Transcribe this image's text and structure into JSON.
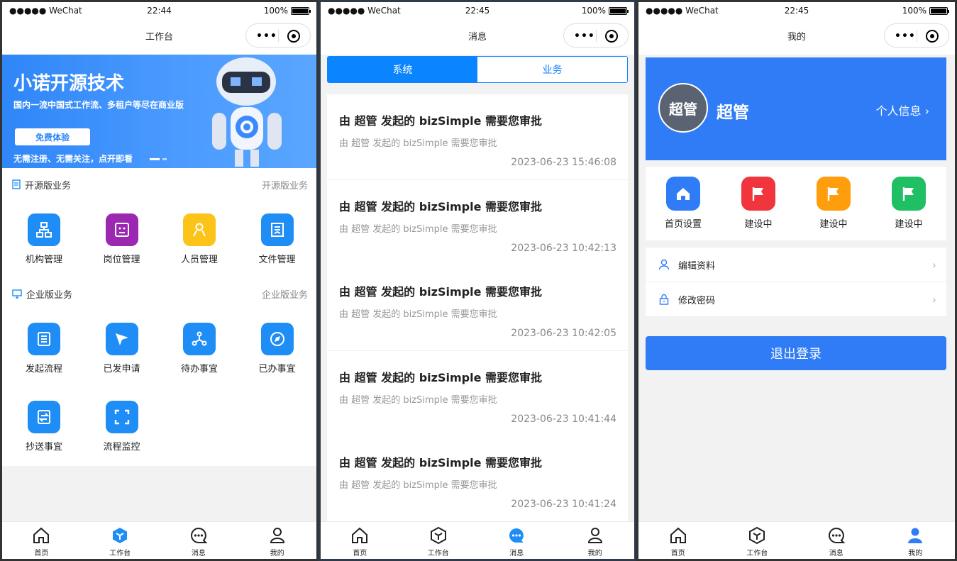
{
  "status": {
    "carrier": "●●●●● WeChat",
    "battery": "100%"
  },
  "phone1": {
    "time": "22:44",
    "title": "工作台",
    "banner": {
      "title": "小诺开源技术",
      "subtitle": "国内一流中国式工作流、多租户等尽在商业版",
      "button": "免费体验",
      "note": "无需注册、无需关注，点开即看"
    },
    "section1": {
      "title": "开源版业务",
      "more": "开源版业务",
      "items": [
        {
          "label": "机构管理",
          "color": "#1e8ef6",
          "icon": "org-icon"
        },
        {
          "label": "岗位管理",
          "color": "#9c27b0",
          "icon": "position-icon"
        },
        {
          "label": "人员管理",
          "color": "#fcc419",
          "icon": "user-icon"
        },
        {
          "label": "文件管理",
          "color": "#1e8ef6",
          "icon": "file-icon"
        }
      ]
    },
    "section2": {
      "title": "企业版业务",
      "more": "企业版业务",
      "items": [
        {
          "label": "发起流程",
          "color": "#1e8ef6",
          "icon": "start-flow-icon"
        },
        {
          "label": "已发申请",
          "color": "#1e8ef6",
          "icon": "sent-icon"
        },
        {
          "label": "待办事宜",
          "color": "#1e8ef6",
          "icon": "todo-icon"
        },
        {
          "label": "已办事宜",
          "color": "#1e8ef6",
          "icon": "done-icon"
        },
        {
          "label": "抄送事宜",
          "color": "#1e8ef6",
          "icon": "cc-icon"
        },
        {
          "label": "流程监控",
          "color": "#1e8ef6",
          "icon": "monitor-icon"
        }
      ]
    }
  },
  "phone2": {
    "time": "22:45",
    "title": "消息",
    "tabs": [
      "系统",
      "业务"
    ],
    "messages": [
      {
        "title": "由 超管 发起的 bizSimple 需要您审批",
        "sub": "由 超管 发起的 bizSimple 需要您审批",
        "date": "2023-06-23 15:46:08"
      },
      {
        "title": "由 超管 发起的 bizSimple 需要您审批",
        "sub": "由 超管 发起的 bizSimple 需要您审批",
        "date": "2023-06-23 10:42:13"
      },
      {
        "title": "由 超管 发起的 bizSimple 需要您审批",
        "sub": "由 超管 发起的 bizSimple 需要您审批",
        "date": "2023-06-23 10:42:05"
      },
      {
        "title": "由 超管 发起的 bizSimple 需要您审批",
        "sub": "由 超管 发起的 bizSimple 需要您审批",
        "date": "2023-06-23 10:41:44"
      },
      {
        "title": "由 超管 发起的 bizSimple 需要您审批",
        "sub": "由 超管 发起的 bizSimple 需要您审批",
        "date": "2023-06-23 10:41:24"
      }
    ]
  },
  "phone3": {
    "time": "22:45",
    "title": "我的",
    "avatar": "超管",
    "name": "超管",
    "info": "个人信息",
    "quick": [
      {
        "label": "首页设置",
        "color": "#2f7cf6",
        "icon": "home-icon"
      },
      {
        "label": "建设中",
        "color": "#f0353d",
        "icon": "flag-icon"
      },
      {
        "label": "建设中",
        "color": "#ff9e0d",
        "icon": "flag-icon"
      },
      {
        "label": "建设中",
        "color": "#1fbf63",
        "icon": "flag-icon"
      }
    ],
    "menu": [
      "编辑资料",
      "修改密码"
    ],
    "logout": "退出登录"
  },
  "tabbar": [
    "首页",
    "工作台",
    "消息",
    "我的"
  ],
  "accent": "#2f7cf6"
}
